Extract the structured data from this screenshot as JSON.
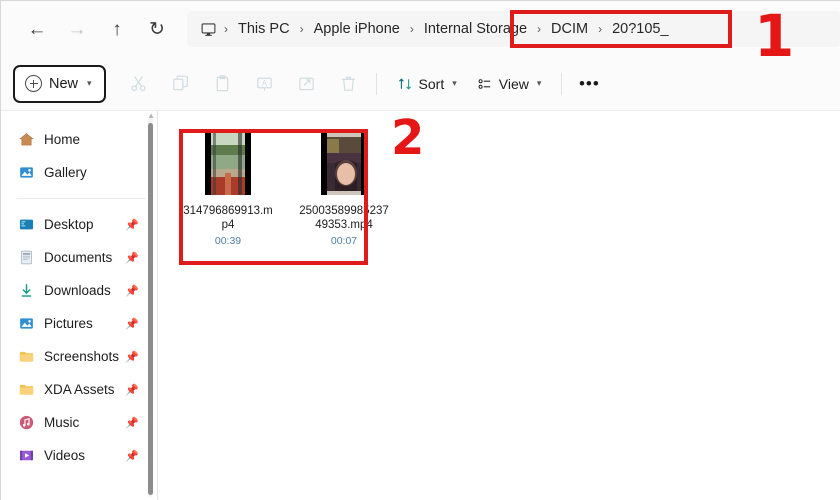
{
  "window": {
    "app": "File Explorer"
  },
  "nav": {
    "back": "←",
    "forward": "→",
    "up": "↑",
    "refresh": "↻",
    "back_name": "Back",
    "forward_name": "Forward",
    "up_name": "Up",
    "refresh_name": "Refresh"
  },
  "breadcrumb": {
    "device_icon": "this-pc-icon",
    "separator": "›",
    "items": [
      {
        "label": "This PC",
        "highlighted": false
      },
      {
        "label": "Apple iPhone",
        "highlighted": false
      },
      {
        "label": "Internal Storage",
        "highlighted": true
      },
      {
        "label": "DCIM",
        "highlighted": true
      },
      {
        "label": "20?105_",
        "highlighted": false
      }
    ]
  },
  "toolbar": {
    "new_label": "New",
    "chevron": "⌄",
    "icons": [
      {
        "name": "cut-icon",
        "glyph": "✂"
      },
      {
        "name": "copy-icon",
        "glyph": "⧉"
      },
      {
        "name": "paste-icon",
        "glyph": "Ὄb"
      },
      {
        "name": "rename-icon",
        "glyph": "A"
      },
      {
        "name": "share-icon",
        "glyph": "↪"
      },
      {
        "name": "delete-icon",
        "glyph": "Ὕ1"
      }
    ],
    "sort_label": "Sort",
    "view_label": "View",
    "more_label": "•••"
  },
  "sidebar": {
    "groups": [
      {
        "items": [
          {
            "label": "Home",
            "icon": "home-icon",
            "pinned": false
          },
          {
            "label": "Gallery",
            "icon": "gallery-icon",
            "pinned": false
          }
        ]
      },
      {
        "items": [
          {
            "label": "Desktop",
            "icon": "desktop-icon",
            "pinned": true
          },
          {
            "label": "Documents",
            "icon": "documents-icon",
            "pinned": true
          },
          {
            "label": "Downloads",
            "icon": "downloads-icon",
            "pinned": true
          },
          {
            "label": "Pictures",
            "icon": "pictures-icon",
            "pinned": true
          },
          {
            "label": "Screenshots",
            "icon": "folder-icon",
            "pinned": true
          },
          {
            "label": "XDA Assets",
            "icon": "folder-icon",
            "pinned": true
          },
          {
            "label": "Music",
            "icon": "music-icon",
            "pinned": true
          },
          {
            "label": "Videos",
            "icon": "videos-icon",
            "pinned": true
          }
        ]
      }
    ],
    "pin_glyph": "📌"
  },
  "files": [
    {
      "name": "314796869913.mp4",
      "duration": "00:39",
      "type": "video",
      "thumbnail": "outdoor-river-scene"
    },
    {
      "name": "2500358998523749353.mp4",
      "duration": "00:07",
      "type": "video",
      "thumbnail": "portrait-selfie"
    }
  ],
  "annotations": {
    "marker_1": "1",
    "marker_2": "2",
    "color": "#e41616"
  }
}
